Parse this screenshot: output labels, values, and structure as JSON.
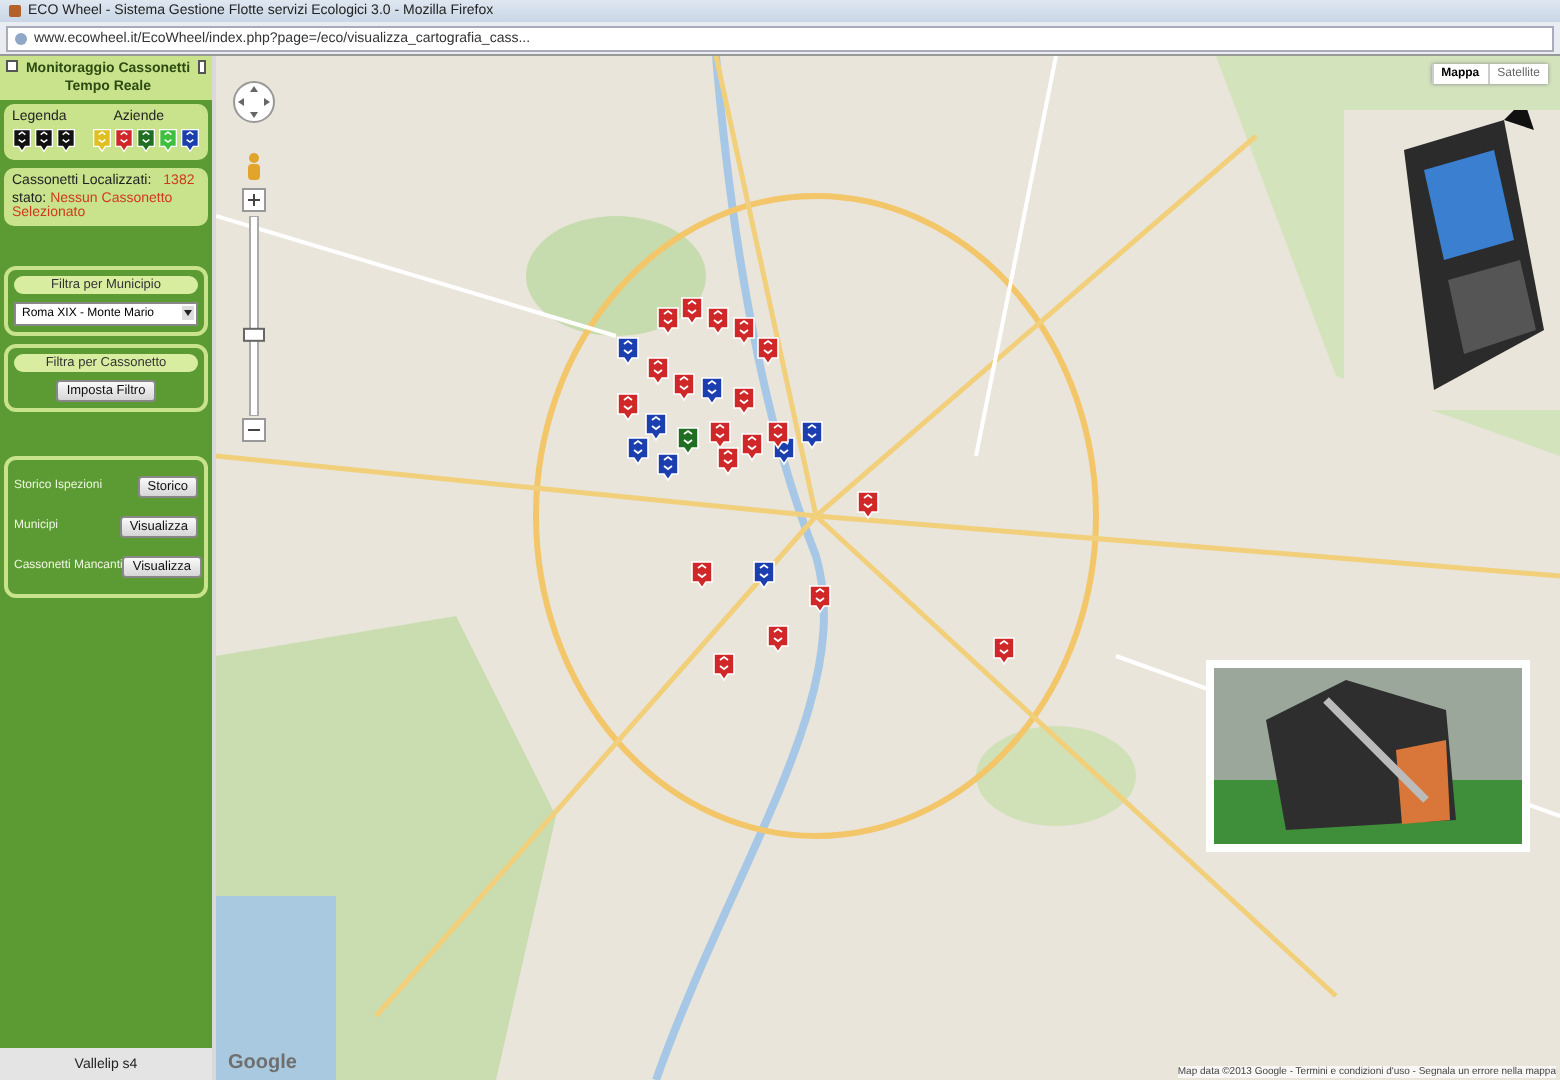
{
  "window": {
    "title": "ECO Wheel - Sistema Gestione Flotte servizi Ecologici 3.0 - Mozilla Firefox"
  },
  "address_bar": {
    "url": "www.ecowheel.it/EcoWheel/index.php?page=/eco/visualizza_cartografia_cass..."
  },
  "panel": {
    "title": "Monitoraggio Cassonetti Tempo Reale",
    "legend_label": "Legenda",
    "companies_label": "Aziende",
    "companies": [
      {
        "color": "#e0c020"
      },
      {
        "color": "#d02828"
      },
      {
        "color": "#1f6e22"
      },
      {
        "color": "#3fbf3f"
      },
      {
        "color": "#1c3fb0"
      }
    ],
    "located_label": "Cassonetti Localizzati:",
    "located_count": "1382",
    "status_label": "stato:",
    "status_value": "Nessun Cassonetto Selezionato",
    "municipio_filter": {
      "title": "Filtra per Municipio",
      "value": "Roma XIX - Monte Mario"
    },
    "bin_filter": {
      "title": "Filtra per Cassonetto",
      "button": "Imposta Filtro"
    },
    "actions": [
      {
        "label": "Storico Ispezioni",
        "button": "Storico"
      },
      {
        "label": "Municipi",
        "button": "Visualizza"
      },
      {
        "label": "Cassonetti Mancanti",
        "button": "Visualizza"
      }
    ],
    "footer": "Vallelip s4"
  },
  "map": {
    "map_types": [
      {
        "label": "Mappa",
        "selected": true
      },
      {
        "label": "Satellite",
        "selected": false
      }
    ],
    "markers": [
      {
        "color": "#1c3fb0"
      },
      {
        "color": "#d02828"
      },
      {
        "color": "#1f6e22"
      }
    ],
    "logo": "Google",
    "zoom": {
      "level": 0.4
    },
    "attribution": "Map data ©2013 Google - Termini e condizioni d'uso - Segnala un errore nella mappa"
  }
}
